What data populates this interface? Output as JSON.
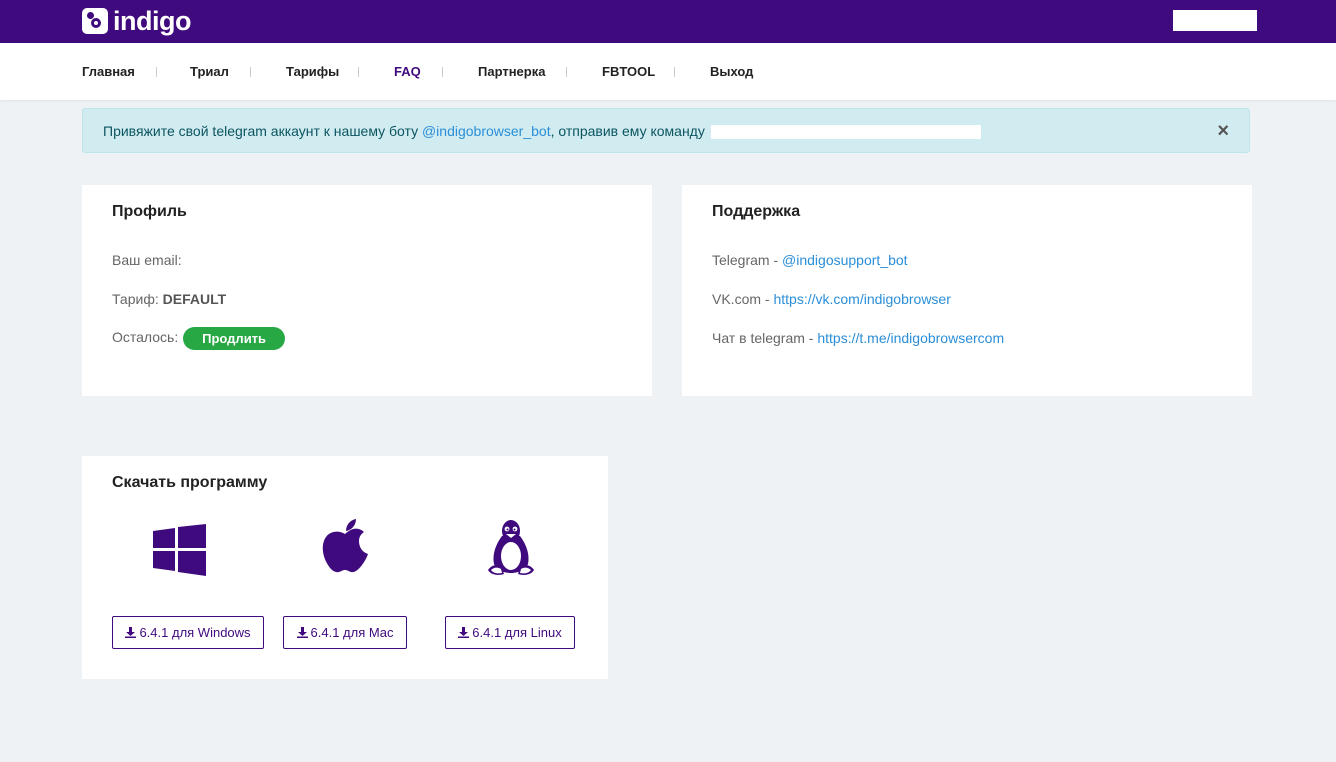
{
  "header": {
    "logo_text": "indigo"
  },
  "nav": {
    "items": [
      {
        "label": "Главная"
      },
      {
        "label": "Триал"
      },
      {
        "label": "Тарифы"
      },
      {
        "label": "FAQ"
      },
      {
        "label": "Партнерка"
      },
      {
        "label": "FBTOOL"
      },
      {
        "label": "Выход"
      }
    ]
  },
  "alert": {
    "text_before": "Привяжите свой telegram аккаунт к нашему боту ",
    "bot_link": "@indigobrowser_bot",
    "text_after": ", отправив ему команду ",
    "close": "×"
  },
  "profile": {
    "title": "Профиль",
    "email_label": "Ваш email:",
    "tariff_label": "Тариф: ",
    "tariff_value": "DEFAULT",
    "remaining_label": "Осталось: ",
    "extend_button": "Продлить"
  },
  "support": {
    "title": "Поддержка",
    "telegram_label": "Telegram - ",
    "telegram_link": "@indigosupport_bot",
    "vk_label": "VK.com - ",
    "vk_link": "https://vk.com/indigobrowser",
    "chat_label": "Чат в telegram - ",
    "chat_link": "https://t.me/indigobrowsercom"
  },
  "download": {
    "title": "Скачать программу",
    "windows": {
      "label": "6.4.1 для Windows",
      "icon": "windows-icon"
    },
    "mac": {
      "label": "6.4.1 для Mac",
      "icon": "apple-icon"
    },
    "linux": {
      "label": "6.4.1 для Linux",
      "icon": "linux-tux-icon"
    }
  },
  "colors": {
    "brand": "#3f0a7d",
    "link": "#2b8ed8",
    "success": "#28a745",
    "alert_bg": "#d1ecf1"
  }
}
